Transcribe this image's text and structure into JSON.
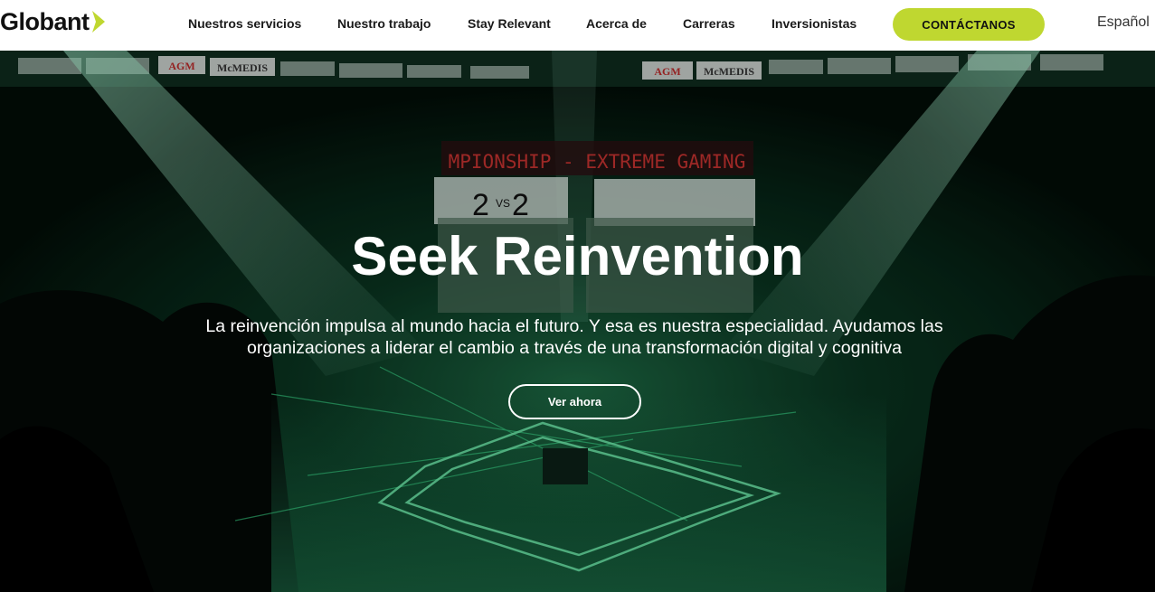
{
  "brand": {
    "name": "Globant",
    "accent_color": "#bfd730",
    "arrow_icon": "chevron-right-icon"
  },
  "nav": {
    "items": [
      {
        "label": "Nuestros servicios"
      },
      {
        "label": "Nuestro trabajo"
      },
      {
        "label": "Stay Relevant"
      },
      {
        "label": "Acerca de"
      },
      {
        "label": "Carreras"
      },
      {
        "label": "Inversionistas"
      }
    ],
    "contact_label": "CONTÁCTANOS",
    "language": "Español"
  },
  "hero": {
    "title": "Seek Reinvention",
    "subtitle": "La reinvención impulsa al mundo hacia el futuro. Y esa es nuestra especialidad. Ayudamos las organizaciones a liderar el cambio a través de una transformación digital y cognitiva",
    "cta_label": "Ver ahora",
    "background": {
      "scoreboard_banner": "MPIONSHIP - EXTREME GAMING",
      "score_left": "2",
      "score_right": "2",
      "versus": "VS",
      "sponsor_ads": [
        "AGM",
        "McMEDIS",
        "AGM",
        "McMEDIS"
      ]
    }
  }
}
